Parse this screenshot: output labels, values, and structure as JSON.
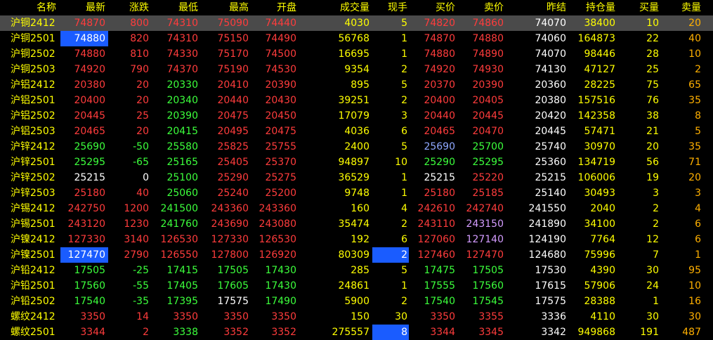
{
  "colors": {
    "up": "#ff3c3c",
    "down": "#3cff3c",
    "flat": "#ffffff",
    "header": "#ffff00",
    "highlight": "#1a5cff",
    "selected_row": "#4a4a4a"
  },
  "headers": [
    "名称",
    "最新",
    "涨跌",
    "最低",
    "最高",
    "开盘",
    "成交量",
    "现手",
    "买价",
    "卖价",
    "昨结",
    "持仓量",
    "买量",
    "卖量"
  ],
  "rows": [
    {
      "name": "沪铜2412",
      "last": "74870",
      "chg": "800",
      "low": "74310",
      "high": "75090",
      "open": "74440",
      "vol": "4030",
      "cur": "5",
      "bid": "74820",
      "ask": "74860",
      "pre": "74070",
      "oi": "38400",
      "bq": "10",
      "aq": "20",
      "dir": "up"
    },
    {
      "name": "沪铜2501",
      "last": "74880",
      "chg": "820",
      "low": "74310",
      "high": "75150",
      "open": "74490",
      "vol": "56768",
      "cur": "1",
      "bid": "74870",
      "ask": "74880",
      "pre": "74060",
      "oi": "164873",
      "bq": "22",
      "aq": "40",
      "dir": "up"
    },
    {
      "name": "沪铜2502",
      "last": "74880",
      "chg": "810",
      "low": "74330",
      "high": "75170",
      "open": "74500",
      "vol": "16695",
      "cur": "1",
      "bid": "74880",
      "ask": "74890",
      "pre": "74070",
      "oi": "98446",
      "bq": "28",
      "aq": "10",
      "dir": "up"
    },
    {
      "name": "沪铜2503",
      "last": "74920",
      "chg": "790",
      "low": "74370",
      "high": "75190",
      "open": "74530",
      "vol": "9354",
      "cur": "2",
      "bid": "74920",
      "ask": "74930",
      "pre": "74130",
      "oi": "47127",
      "bq": "25",
      "aq": "2",
      "dir": "up"
    },
    {
      "name": "沪铝2412",
      "last": "20380",
      "chg": "20",
      "low": "20330",
      "high": "20410",
      "open": "20390",
      "vol": "895",
      "cur": "5",
      "bid": "20370",
      "ask": "20390",
      "pre": "20360",
      "oi": "28225",
      "bq": "75",
      "aq": "65",
      "dir": "up"
    },
    {
      "name": "沪铝2501",
      "last": "20400",
      "chg": "20",
      "low": "20340",
      "high": "20440",
      "open": "20430",
      "vol": "39251",
      "cur": "2",
      "bid": "20400",
      "ask": "20405",
      "pre": "20380",
      "oi": "157516",
      "bq": "76",
      "aq": "35",
      "dir": "up"
    },
    {
      "name": "沪铝2502",
      "last": "20445",
      "chg": "25",
      "low": "20390",
      "high": "20475",
      "open": "20450",
      "vol": "17079",
      "cur": "3",
      "bid": "20440",
      "ask": "20445",
      "pre": "20420",
      "oi": "142358",
      "bq": "38",
      "aq": "8",
      "dir": "up"
    },
    {
      "name": "沪铝2503",
      "last": "20465",
      "chg": "20",
      "low": "20415",
      "high": "20495",
      "open": "20475",
      "vol": "4036",
      "cur": "6",
      "bid": "20465",
      "ask": "20470",
      "pre": "20445",
      "oi": "57471",
      "bq": "21",
      "aq": "5",
      "dir": "up"
    },
    {
      "name": "沪锌2412",
      "last": "25690",
      "chg": "-50",
      "low": "25580",
      "high": "25825",
      "open": "25755",
      "vol": "2400",
      "cur": "5",
      "bid": "25690",
      "ask": "25700",
      "pre": "25740",
      "oi": "30970",
      "bq": "20",
      "aq": "35",
      "dir": "down"
    },
    {
      "name": "沪锌2501",
      "last": "25295",
      "chg": "-65",
      "low": "25165",
      "high": "25405",
      "open": "25370",
      "vol": "94897",
      "cur": "10",
      "bid": "25290",
      "ask": "25295",
      "pre": "25360",
      "oi": "134719",
      "bq": "56",
      "aq": "71",
      "dir": "down"
    },
    {
      "name": "沪锌2502",
      "last": "25215",
      "chg": "0",
      "low": "25100",
      "high": "25290",
      "open": "25275",
      "vol": "36529",
      "cur": "1",
      "bid": "25215",
      "ask": "25220",
      "pre": "25215",
      "oi": "106006",
      "bq": "19",
      "aq": "20",
      "dir": "flat"
    },
    {
      "name": "沪锌2503",
      "last": "25180",
      "chg": "40",
      "low": "25060",
      "high": "25240",
      "open": "25200",
      "vol": "9748",
      "cur": "1",
      "bid": "25180",
      "ask": "25185",
      "pre": "25140",
      "oi": "30493",
      "bq": "3",
      "aq": "3",
      "dir": "up"
    },
    {
      "name": "沪锡2412",
      "last": "242750",
      "chg": "1200",
      "low": "241500",
      "high": "243360",
      "open": "243360",
      "vol": "160",
      "cur": "4",
      "bid": "242610",
      "ask": "242740",
      "pre": "241550",
      "oi": "2040",
      "bq": "2",
      "aq": "4",
      "dir": "up"
    },
    {
      "name": "沪锡2501",
      "last": "243120",
      "chg": "1230",
      "low": "241760",
      "high": "243690",
      "open": "243080",
      "vol": "35474",
      "cur": "2",
      "bid": "243110",
      "ask": "243150",
      "pre": "241890",
      "oi": "34100",
      "bq": "2",
      "aq": "6",
      "dir": "up"
    },
    {
      "name": "沪镍2412",
      "last": "127330",
      "chg": "3140",
      "low": "126530",
      "high": "127330",
      "open": "126530",
      "vol": "192",
      "cur": "6",
      "bid": "127060",
      "ask": "127140",
      "pre": "124190",
      "oi": "7764",
      "bq": "12",
      "aq": "6",
      "dir": "up"
    },
    {
      "name": "沪镍2501",
      "last": "127470",
      "chg": "2790",
      "low": "126550",
      "high": "127800",
      "open": "126920",
      "vol": "80309",
      "cur": "2",
      "bid": "127460",
      "ask": "127470",
      "pre": "124680",
      "oi": "75996",
      "bq": "7",
      "aq": "1",
      "dir": "up"
    },
    {
      "name": "沪铅2412",
      "last": "17505",
      "chg": "-25",
      "low": "17415",
      "high": "17505",
      "open": "17430",
      "vol": "285",
      "cur": "5",
      "bid": "17475",
      "ask": "17505",
      "pre": "17530",
      "oi": "4390",
      "bq": "30",
      "aq": "95",
      "dir": "down"
    },
    {
      "name": "沪铅2501",
      "last": "17560",
      "chg": "-55",
      "low": "17405",
      "high": "17605",
      "open": "17430",
      "vol": "24861",
      "cur": "1",
      "bid": "17555",
      "ask": "17560",
      "pre": "17615",
      "oi": "57906",
      "bq": "24",
      "aq": "10",
      "dir": "down"
    },
    {
      "name": "沪铅2502",
      "last": "17540",
      "chg": "-35",
      "low": "17395",
      "high": "17575",
      "open": "17490",
      "vol": "5900",
      "cur": "2",
      "bid": "17540",
      "ask": "17545",
      "pre": "17575",
      "oi": "28388",
      "bq": "1",
      "aq": "16",
      "dir": "down"
    },
    {
      "name": "螺纹2412",
      "last": "3350",
      "chg": "14",
      "low": "3350",
      "high": "3350",
      "open": "3350",
      "vol": "150",
      "cur": "30",
      "bid": "3350",
      "ask": "3355",
      "pre": "3336",
      "oi": "4110",
      "bq": "30",
      "aq": "30",
      "dir": "up"
    },
    {
      "name": "螺纹2501",
      "last": "3344",
      "chg": "2",
      "low": "3338",
      "high": "3352",
      "open": "3352",
      "vol": "275557",
      "cur": "8",
      "bid": "3344",
      "ask": "3345",
      "pre": "3342",
      "oi": "949868",
      "bq": "191",
      "aq": "487",
      "dir": "up"
    }
  ]
}
